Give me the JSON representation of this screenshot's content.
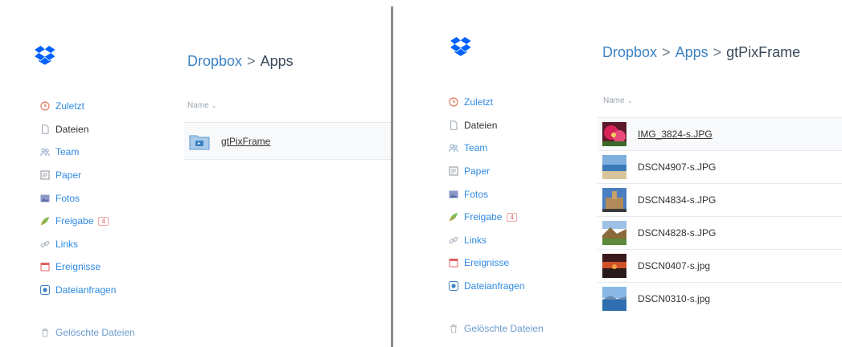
{
  "left": {
    "breadcrumb": [
      "Dropbox",
      "Apps"
    ],
    "nav": [
      {
        "label": "Zuletzt",
        "icon": "clock-icon"
      },
      {
        "label": "Dateien",
        "icon": "file-icon",
        "active": true
      },
      {
        "label": "Team",
        "icon": "team-icon"
      },
      {
        "label": "Paper",
        "icon": "paper-icon"
      },
      {
        "label": "Fotos",
        "icon": "photos-icon"
      },
      {
        "label": "Freigabe",
        "icon": "share-icon",
        "badge": "4"
      },
      {
        "label": "Links",
        "icon": "link-icon"
      },
      {
        "label": "Ereignisse",
        "icon": "calendar-icon"
      },
      {
        "label": "Dateianfragen",
        "icon": "file-request-icon"
      }
    ],
    "deleted_label": "Gelöschte Dateien",
    "column_header": "Name",
    "files": [
      {
        "name": "gtPixFrame",
        "icon": "app-folder-icon"
      }
    ]
  },
  "right": {
    "breadcrumb": [
      "Dropbox",
      "Apps",
      "gtPixFrame"
    ],
    "nav": [
      {
        "label": "Zuletzt",
        "icon": "clock-icon"
      },
      {
        "label": "Dateien",
        "icon": "file-icon",
        "active": true
      },
      {
        "label": "Team",
        "icon": "team-icon"
      },
      {
        "label": "Paper",
        "icon": "paper-icon"
      },
      {
        "label": "Fotos",
        "icon": "photos-icon"
      },
      {
        "label": "Freigabe",
        "icon": "share-icon",
        "badge": "4"
      },
      {
        "label": "Links",
        "icon": "link-icon"
      },
      {
        "label": "Ereignisse",
        "icon": "calendar-icon"
      },
      {
        "label": "Dateianfragen",
        "icon": "file-request-icon"
      }
    ],
    "deleted_label": "Gelöschte Dateien",
    "column_header": "Name",
    "files": [
      {
        "name": "IMG_3824-s.JPG",
        "thumb": "flower-thumbnail-icon"
      },
      {
        "name": "DSCN4907-s.JPG",
        "thumb": "beach-thumbnail-icon"
      },
      {
        "name": "DSCN4834-s.JPG",
        "thumb": "building-thumbnail-icon"
      },
      {
        "name": "DSCN4828-s.JPG",
        "thumb": "landscape-thumbnail-icon"
      },
      {
        "name": "DSCN0407-s.jpg",
        "thumb": "sunset-thumbnail-icon"
      },
      {
        "name": "DSCN0310-s.jpg",
        "thumb": "sea-thumbnail-icon"
      }
    ]
  },
  "colors": {
    "link": "#2e8ae0",
    "breadcrumb_link": "#3d82c4",
    "dropbox_blue": "#0061ff"
  }
}
